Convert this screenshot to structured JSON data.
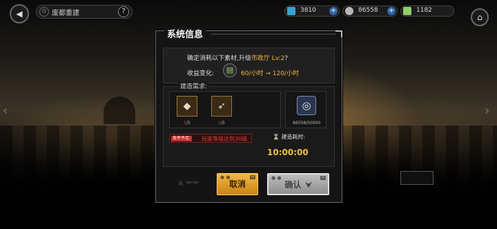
{
  "header": {
    "title": "废都重建",
    "help": "?"
  },
  "resources": [
    {
      "value": "3810",
      "color": "#3aa2d0"
    },
    {
      "value": "86558",
      "color": "#b8b8b8"
    },
    {
      "value": "1182",
      "color": "#8fce6a"
    }
  ],
  "dialog": {
    "title": "系统信息",
    "confirm_prefix": "确定消耗以下素材,升级",
    "confirm_target": "市政厅 Lv:2",
    "confirm_suffix": "?",
    "income_label": "收益变化:",
    "income_value": "60/小时 → 120/小时",
    "requirements_label": "建造需求:",
    "materials": [
      {
        "have": "1",
        "need": "/5"
      },
      {
        "have": "1",
        "need": "/5"
      }
    ],
    "coin_count": "86558/50000",
    "condition_tag": "条件不足:",
    "condition_text": "玩家等级达到30级",
    "time_label": "建造耗时:",
    "time_value": "10:00:00",
    "cancel_label": "取消",
    "confirm_label": "确认"
  }
}
